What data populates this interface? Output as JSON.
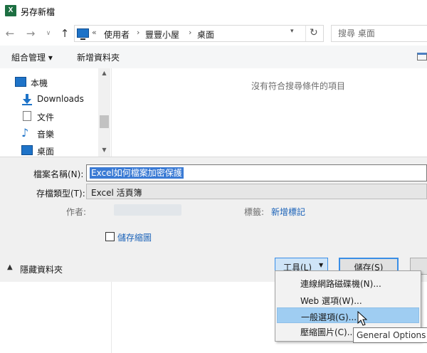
{
  "window": {
    "app_icon_letter": "X",
    "title": "另存新檔"
  },
  "nav": {
    "back_glyph": "←",
    "forward_glyph": "→",
    "recent_glyph": "∨",
    "up_glyph": "↑",
    "breadcrumb": [
      "«",
      "使用者",
      "›",
      "豐豐小屋",
      "›",
      "桌面"
    ],
    "search_placeholder": "搜尋 桌面"
  },
  "commands": {
    "organize": "組合管理 ▾",
    "new_folder": "新增資料夾"
  },
  "sidebar": {
    "items": [
      {
        "label": "本機",
        "icon": "computer-icon"
      },
      {
        "label": "Downloads",
        "icon": "download-arrow-icon"
      },
      {
        "label": "文件",
        "icon": "document-icon"
      },
      {
        "label": "音樂",
        "icon": "music-note-icon"
      },
      {
        "label": "桌面",
        "icon": "desktop-icon"
      }
    ]
  },
  "file_list": {
    "empty_message": "沒有符合搜尋條件的項目"
  },
  "form": {
    "filename_label": "檔案名稱(N):",
    "filename_value": "Excel如何檔案加密保護",
    "filetype_label": "存檔類型(T):",
    "filetype_value": "Excel 活頁簿",
    "author_label": "作者:",
    "tags_label": "標籤:",
    "tags_link": "新增標記",
    "thumbnail_label": "儲存縮圖"
  },
  "footer": {
    "hide_folders": "隱藏資料夾",
    "tools": "工具(L)",
    "save": "儲存(S)"
  },
  "tools_menu": {
    "items": [
      "連線網路磁碟機(N)...",
      "Web 選項(W)...",
      "一般選項(G)...",
      "壓縮圖片(C)..."
    ],
    "highlighted_index": 2
  },
  "tooltip": "General Options",
  "colors": {
    "accent": "#3a8ee6",
    "selection": "#3a7ad4",
    "link": "#1a62b8",
    "menu_highlight": "#9fcdf2"
  }
}
